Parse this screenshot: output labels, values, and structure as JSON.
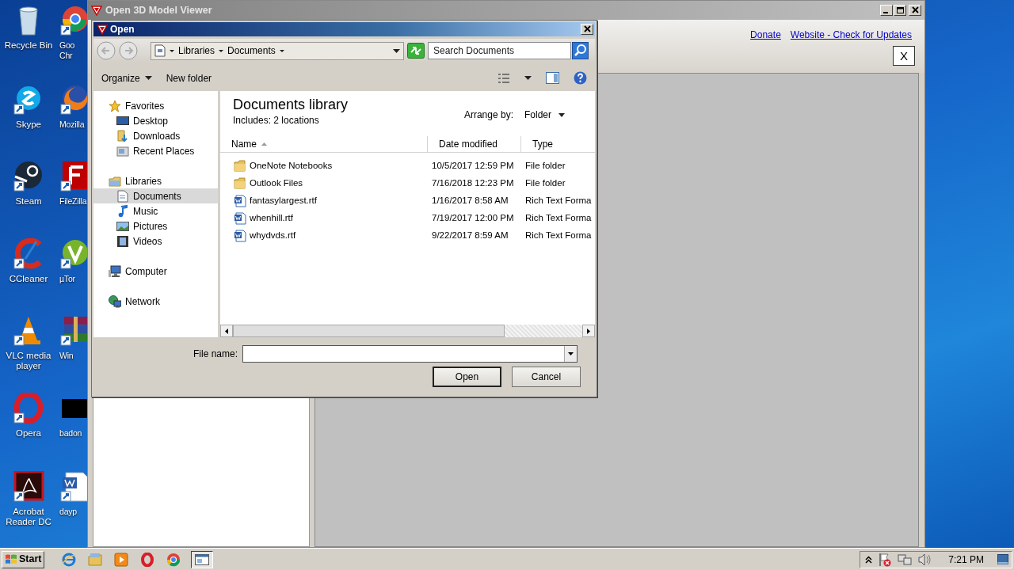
{
  "desktop": {
    "column_1": [
      {
        "label": "Recycle Bin"
      },
      {
        "label": "Skype"
      },
      {
        "label": "Steam"
      },
      {
        "label": "CCleaner"
      },
      {
        "label": "VLC media player"
      },
      {
        "label": "Opera"
      },
      {
        "label": "Acrobat Reader DC"
      }
    ],
    "column_2": [
      {
        "label": "Goo Chr"
      },
      {
        "label": "Mozilla"
      },
      {
        "label": "FileZilla"
      },
      {
        "label": "µTor"
      },
      {
        "label": "Win"
      },
      {
        "label": "badon"
      },
      {
        "label": "dayp"
      }
    ]
  },
  "main_window": {
    "title": "Open 3D Model Viewer",
    "links": [
      "Donate",
      "Website - Check for Updates"
    ],
    "close_button": "X"
  },
  "dialog": {
    "title": "Open",
    "breadcrumb": [
      "Libraries",
      "Documents"
    ],
    "search": {
      "placeholder": "Search Documents"
    },
    "toolbar": [
      {
        "label": "Organize",
        "kind": "menu"
      },
      {
        "label": "New folder",
        "kind": "button"
      }
    ],
    "nav_tree": [
      {
        "label": "Favorites",
        "selected": false,
        "children": [
          {
            "label": "Desktop",
            "selected": false
          },
          {
            "label": "Downloads",
            "selected": false
          },
          {
            "label": "Recent Places",
            "selected": false
          }
        ]
      },
      {
        "label": "Libraries",
        "selected": false,
        "children": [
          {
            "label": "Documents",
            "selected": true
          },
          {
            "label": "Music",
            "selected": false
          },
          {
            "label": "Pictures",
            "selected": false
          },
          {
            "label": "Videos",
            "selected": false
          }
        ]
      },
      {
        "label": "Computer",
        "selected": false
      },
      {
        "label": "Network",
        "selected": false
      }
    ],
    "library": {
      "title": "Documents library",
      "includes": "Includes:  2 locations",
      "arrange_label": "Arrange by:",
      "arrange_value": "Folder"
    },
    "columns": [
      {
        "label": "Name",
        "sorted": true
      },
      {
        "label": "Date modified",
        "sorted": false
      },
      {
        "label": "Type",
        "sorted": false
      }
    ],
    "files": [
      {
        "kind": "folder",
        "name": "OneNote Notebooks",
        "date": "10/5/2017 12:59 PM",
        "type": "File folder"
      },
      {
        "kind": "folder",
        "name": "Outlook Files",
        "date": "7/16/2018 12:23 PM",
        "type": "File folder"
      },
      {
        "kind": "document",
        "name": "fantasylargest.rtf",
        "date": "1/16/2017 8:58 AM",
        "type": "Rich Text Forma"
      },
      {
        "kind": "document",
        "name": "whenhill.rtf",
        "date": "7/19/2017 12:00 PM",
        "type": "Rich Text Forma"
      },
      {
        "kind": "document",
        "name": "whydvds.rtf",
        "date": "9/22/2017 8:59 AM",
        "type": "Rich Text Forma"
      }
    ],
    "file_name_label": "File name:",
    "buttons": [
      {
        "label": "Open",
        "default": true
      },
      {
        "label": "Cancel",
        "default": false
      }
    ]
  },
  "taskbar": {
    "start": "Start",
    "clock": "7:21 PM"
  }
}
